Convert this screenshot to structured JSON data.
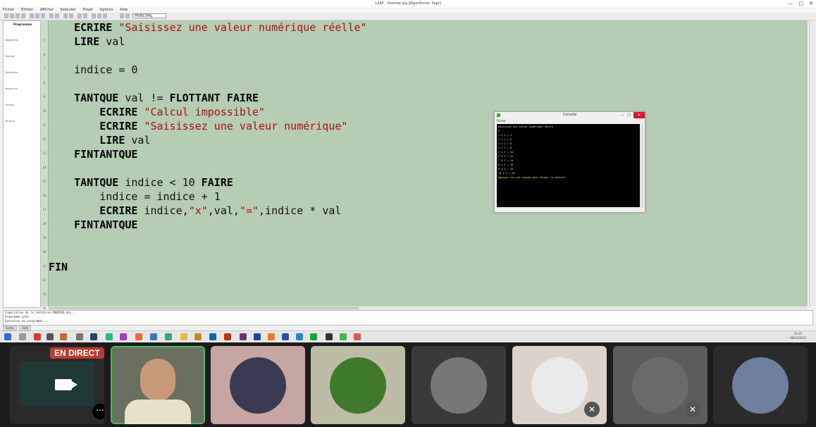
{
  "window": {
    "title": "LARP - Premier.alg [Algorithme: Sept]",
    "buttons": [
      "—",
      "□",
      "✕"
    ]
  },
  "menu": [
    "Fichier",
    "Édition",
    "Afficher",
    "Exécuter",
    "Projet",
    "Options",
    "Aide"
  ],
  "toolbar": {
    "selector_value": "PRINCIPAL"
  },
  "sidebar": {
    "entries": [
      "Programme",
      "Algorithmes",
      "Modules",
      "Documents",
      "Ressources",
      "Console",
      "Tampons"
    ]
  },
  "code_lines": [
    [
      {
        "t": "    "
      },
      {
        "t": "ECRIRE",
        "c": "kw"
      },
      {
        "t": " "
      },
      {
        "t": "\"Saisissez une valeur numérique réelle\"",
        "c": "str"
      }
    ],
    [
      {
        "t": "    "
      },
      {
        "t": "LIRE",
        "c": "kw"
      },
      {
        "t": " val"
      }
    ],
    [
      {
        "t": ""
      }
    ],
    [
      {
        "t": "    indice = 0"
      }
    ],
    [
      {
        "t": ""
      }
    ],
    [
      {
        "t": "    "
      },
      {
        "t": "TANTQUE",
        "c": "kw"
      },
      {
        "t": " val != "
      },
      {
        "t": "FLOTTANT",
        "c": "kw"
      },
      {
        "t": " "
      },
      {
        "t": "FAIRE",
        "c": "kw"
      }
    ],
    [
      {
        "t": "        "
      },
      {
        "t": "ECRIRE",
        "c": "kw"
      },
      {
        "t": " "
      },
      {
        "t": "\"Calcul impossible\"",
        "c": "str"
      }
    ],
    [
      {
        "t": "        "
      },
      {
        "t": "ECRIRE",
        "c": "kw"
      },
      {
        "t": " "
      },
      {
        "t": "\"Saisissez une valeur numérique\"",
        "c": "str"
      }
    ],
    [
      {
        "t": "        "
      },
      {
        "t": "LIRE",
        "c": "kw"
      },
      {
        "t": " val"
      }
    ],
    [
      {
        "t": "    "
      },
      {
        "t": "FINTANTQUE",
        "c": "kw"
      }
    ],
    [
      {
        "t": ""
      }
    ],
    [
      {
        "t": "    "
      },
      {
        "t": "TANTQUE",
        "c": "kw"
      },
      {
        "t": " indice < 10 "
      },
      {
        "t": "FAIRE",
        "c": "kw"
      }
    ],
    [
      {
        "t": "        indice = indice + 1"
      }
    ],
    [
      {
        "t": "        "
      },
      {
        "t": "ECRIRE",
        "c": "kw"
      },
      {
        "t": " indice,"
      },
      {
        "t": "\"x\"",
        "c": "str"
      },
      {
        "t": ",val,"
      },
      {
        "t": "\"=\"",
        "c": "str"
      },
      {
        "t": ",indice * val"
      }
    ],
    [
      {
        "t": "    "
      },
      {
        "t": "FINTANTQUE",
        "c": "kw"
      }
    ],
    [
      {
        "t": ""
      }
    ],
    [
      {
        "t": ""
      }
    ],
    [
      {
        "t": "FIN",
        "c": "kw"
      }
    ]
  ],
  "line_numbers": [
    "5",
    "6",
    "7",
    "8",
    "9",
    "10",
    "11",
    "12",
    "13",
    "14",
    "15",
    "16",
    "17",
    "18",
    "19",
    "20",
    "21",
    "22",
    "23",
    "24"
  ],
  "output_panel": {
    "lines": [
      "Compilation de la tentative PREMIER.ALG...",
      "Programme prêt.",
      "Exécution du programme..."
    ]
  },
  "bottom_tabs": [
    "Sortie",
    "Aide"
  ],
  "taskbar": {
    "time": "11:07",
    "date": "08/12/2023"
  },
  "console": {
    "title": "Console",
    "menu": "Fichier",
    "lines": [
      "Saisissez une valeur numérique réelle",
      "2",
      "1 x 2 = 2",
      "2 x 2 = 4",
      "3 x 2 = 6",
      "4 x 2 = 8",
      "5 x 2 = 10",
      "6 x 2 = 12",
      "7 x 2 = 14",
      "8 x 2 = 16",
      "9 x 2 = 18",
      "10 x 2 = 20"
    ],
    "prompt": "Appuyez sur une touche pour fermer la console..."
  },
  "meeting": {
    "live_badge": "EN DIRECT",
    "more_label": "⋯",
    "tiles": [
      {
        "kind": "screen",
        "bg": "#2a2a2a"
      },
      {
        "kind": "camera",
        "bg": "#6b6f60",
        "active": true
      },
      {
        "kind": "avatar",
        "bg": "#c7a6a1",
        "avatar": "#3a3a55",
        "icon": "person-icon"
      },
      {
        "kind": "avatar",
        "bg": "#bdbca5",
        "avatar": "#3f7a2a",
        "icon": "daisy-icon"
      },
      {
        "kind": "avatar",
        "bg": "#3a3a3a",
        "avatar": "#777777",
        "icon": "photographer-icon"
      },
      {
        "kind": "avatar",
        "bg": "#dbd3cb",
        "avatar": "#eaeaea",
        "icon": "person-icon",
        "muted": true
      },
      {
        "kind": "avatar",
        "bg": "#5c5c5c",
        "avatar": "#6a6a6a",
        "icon": "pixel-character-icon",
        "muted": true
      },
      {
        "kind": "avatar",
        "bg": "#2b2b2b",
        "avatar": "#6e7fa0",
        "icon": "person-icon"
      }
    ],
    "mute_glyph": "🎙̸"
  }
}
